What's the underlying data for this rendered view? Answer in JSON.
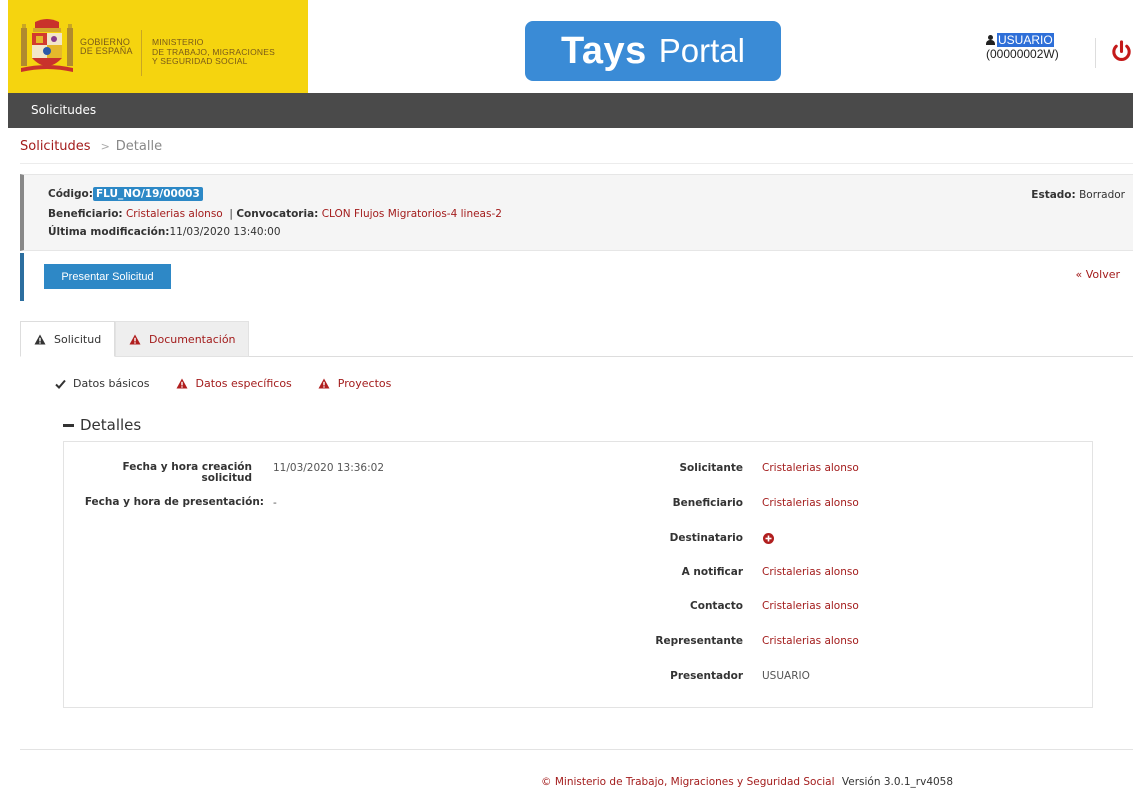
{
  "header": {
    "gov_line1": "GOBIERNO",
    "gov_line2": "DE ESPAÑA",
    "ministry_line1": "MINISTERIO",
    "ministry_line2": "DE TRABAJO, MIGRACIONES",
    "ministry_line3": "Y SEGURIDAD SOCIAL",
    "logo_word1": "Tays",
    "logo_word2": "Portal",
    "user_name": "USUARIO",
    "user_id": "(00000002W)",
    "brand_color": "#3a8bd6",
    "gov_yellow": "#f5d40f",
    "power_color": "#c41a1a"
  },
  "nav": {
    "item": "Solicitudes"
  },
  "breadcrumb": {
    "link": "Solicitudes",
    "separator": ">",
    "current": "Detalle"
  },
  "info": {
    "code_label": "Código:",
    "code_value": "FLU_NO/19/00003",
    "beneficiary_label": "Beneficiario:",
    "beneficiary_value": "Cristalerias alonso",
    "separator": "|",
    "call_label": "Convocatoria:",
    "call_value": "CLON Flujos Migratorios-4 lineas-2",
    "modified_label": "Última modificación:",
    "modified_value": "11/03/2020 13:40:00",
    "status_label": "Estado:",
    "status_value": "Borrador"
  },
  "actions": {
    "submit_label": "Presentar Solicitud",
    "back_label": "« Volver"
  },
  "tabs": [
    {
      "label": "Solicitud",
      "active": true
    },
    {
      "label": "Documentación",
      "active": false
    }
  ],
  "subnav": [
    {
      "label": "Datos básicos",
      "icon": "check-icon"
    },
    {
      "label": "Datos específicos",
      "icon": "warning-icon"
    },
    {
      "label": "Proyectos",
      "icon": "warning-icon"
    }
  ],
  "details": {
    "title": "Detalles",
    "creation_label_line1": "Fecha y hora creación",
    "creation_label_line2": "solicitud",
    "creation_value": "11/03/2020 13:36:02",
    "submission_label": "Fecha y hora de presentación:",
    "submission_value": "-",
    "right_fields": [
      {
        "label": "Solicitante",
        "value": "Cristalerias alonso"
      },
      {
        "label": "Beneficiario",
        "value": "Cristalerias alonso"
      },
      {
        "label": "Destinatario",
        "value": ""
      },
      {
        "label": "A notificar",
        "value": "Cristalerias alonso"
      },
      {
        "label": "Contacto",
        "value": "Cristalerias alonso"
      },
      {
        "label": "Representante",
        "value": "Cristalerias alonso"
      },
      {
        "label": "Presentador",
        "value": "USUARIO"
      }
    ]
  },
  "footer": {
    "copyright": "© Ministerio de Trabajo, Migraciones y Seguridad Social",
    "version": "Versión 3.0.1_rv4058"
  }
}
